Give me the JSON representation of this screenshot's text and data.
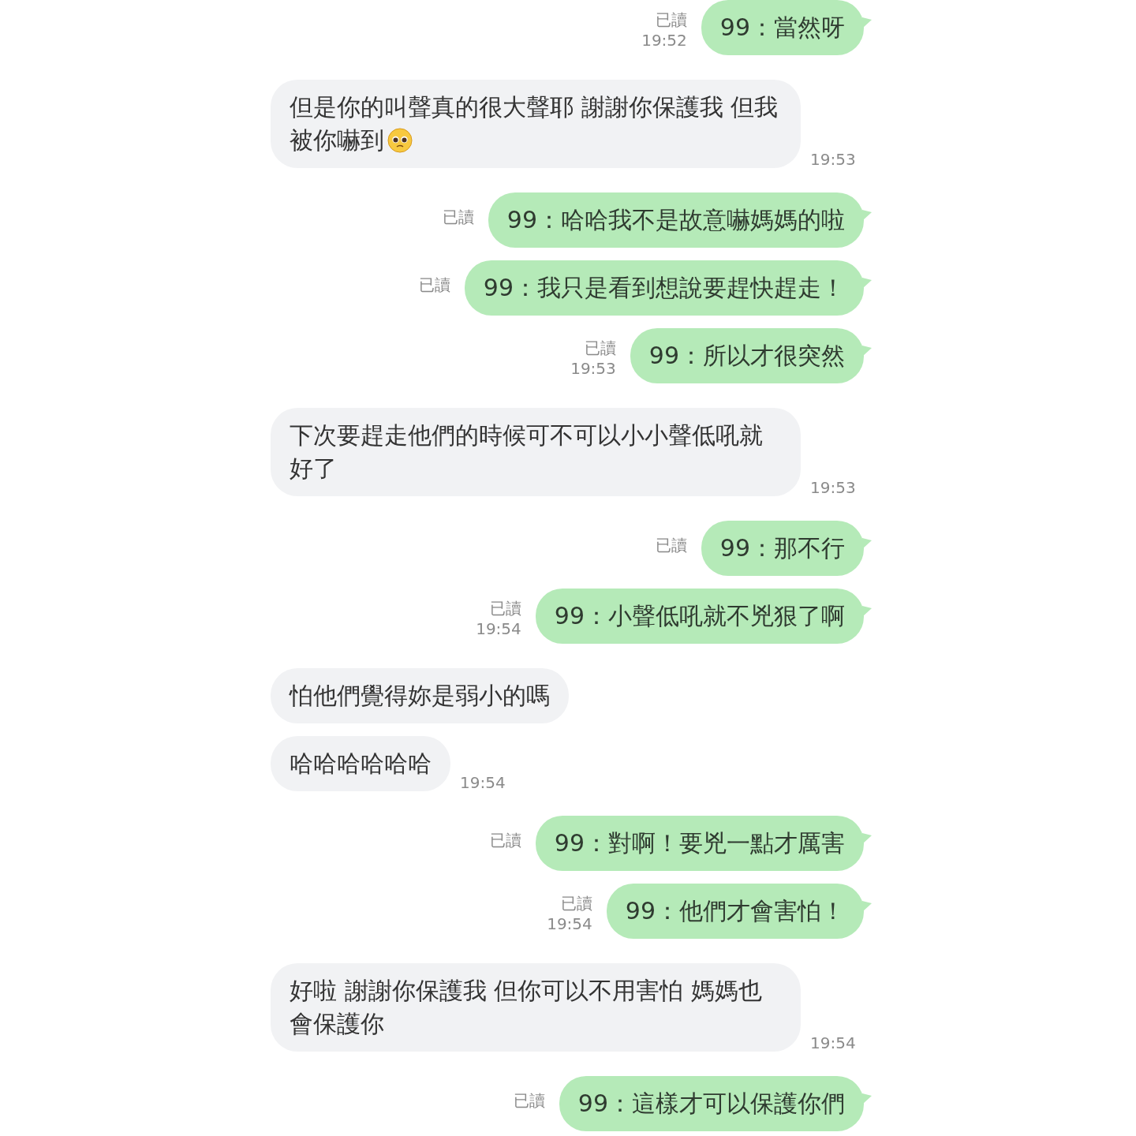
{
  "messages": [
    {
      "kind": "sent",
      "text": "99：當然呀",
      "read_label": "已讀",
      "time": "19:52"
    },
    {
      "kind": "received",
      "text": "但是你的叫聲真的很大聲耶 謝謝你保護我 但我被你嚇到",
      "has_emoji": true,
      "time": "19:53"
    },
    {
      "kind": "sent",
      "text": "99：哈哈我不是故意嚇媽媽的啦",
      "read_label": "已讀"
    },
    {
      "kind": "sent",
      "text": "99：我只是看到想說要趕快趕走！",
      "read_label": "已讀"
    },
    {
      "kind": "sent",
      "text": "99：所以才很突然",
      "read_label": "已讀",
      "time": "19:53"
    },
    {
      "kind": "received",
      "text": "下次要趕走他們的時候可不可以小小聲低吼就好了",
      "time": "19:53"
    },
    {
      "kind": "sent",
      "text": "99：那不行",
      "read_label": "已讀"
    },
    {
      "kind": "sent",
      "text": "99：小聲低吼就不兇狠了啊",
      "read_label": "已讀",
      "time": "19:54"
    },
    {
      "kind": "received",
      "text": "怕他們覺得妳是弱小的嗎"
    },
    {
      "kind": "received",
      "text": "哈哈哈哈哈哈",
      "time": "19:54"
    },
    {
      "kind": "sent",
      "text": "99：對啊！要兇一點才厲害",
      "read_label": "已讀"
    },
    {
      "kind": "sent",
      "text": "99：他們才會害怕！",
      "read_label": "已讀",
      "time": "19:54"
    },
    {
      "kind": "received",
      "text": "好啦 謝謝你保護我 但你可以不用害怕 媽媽也會保護你",
      "time": "19:54"
    },
    {
      "kind": "sent",
      "text": "99：這樣才可以保護你們",
      "read_label": "已讀"
    }
  ]
}
